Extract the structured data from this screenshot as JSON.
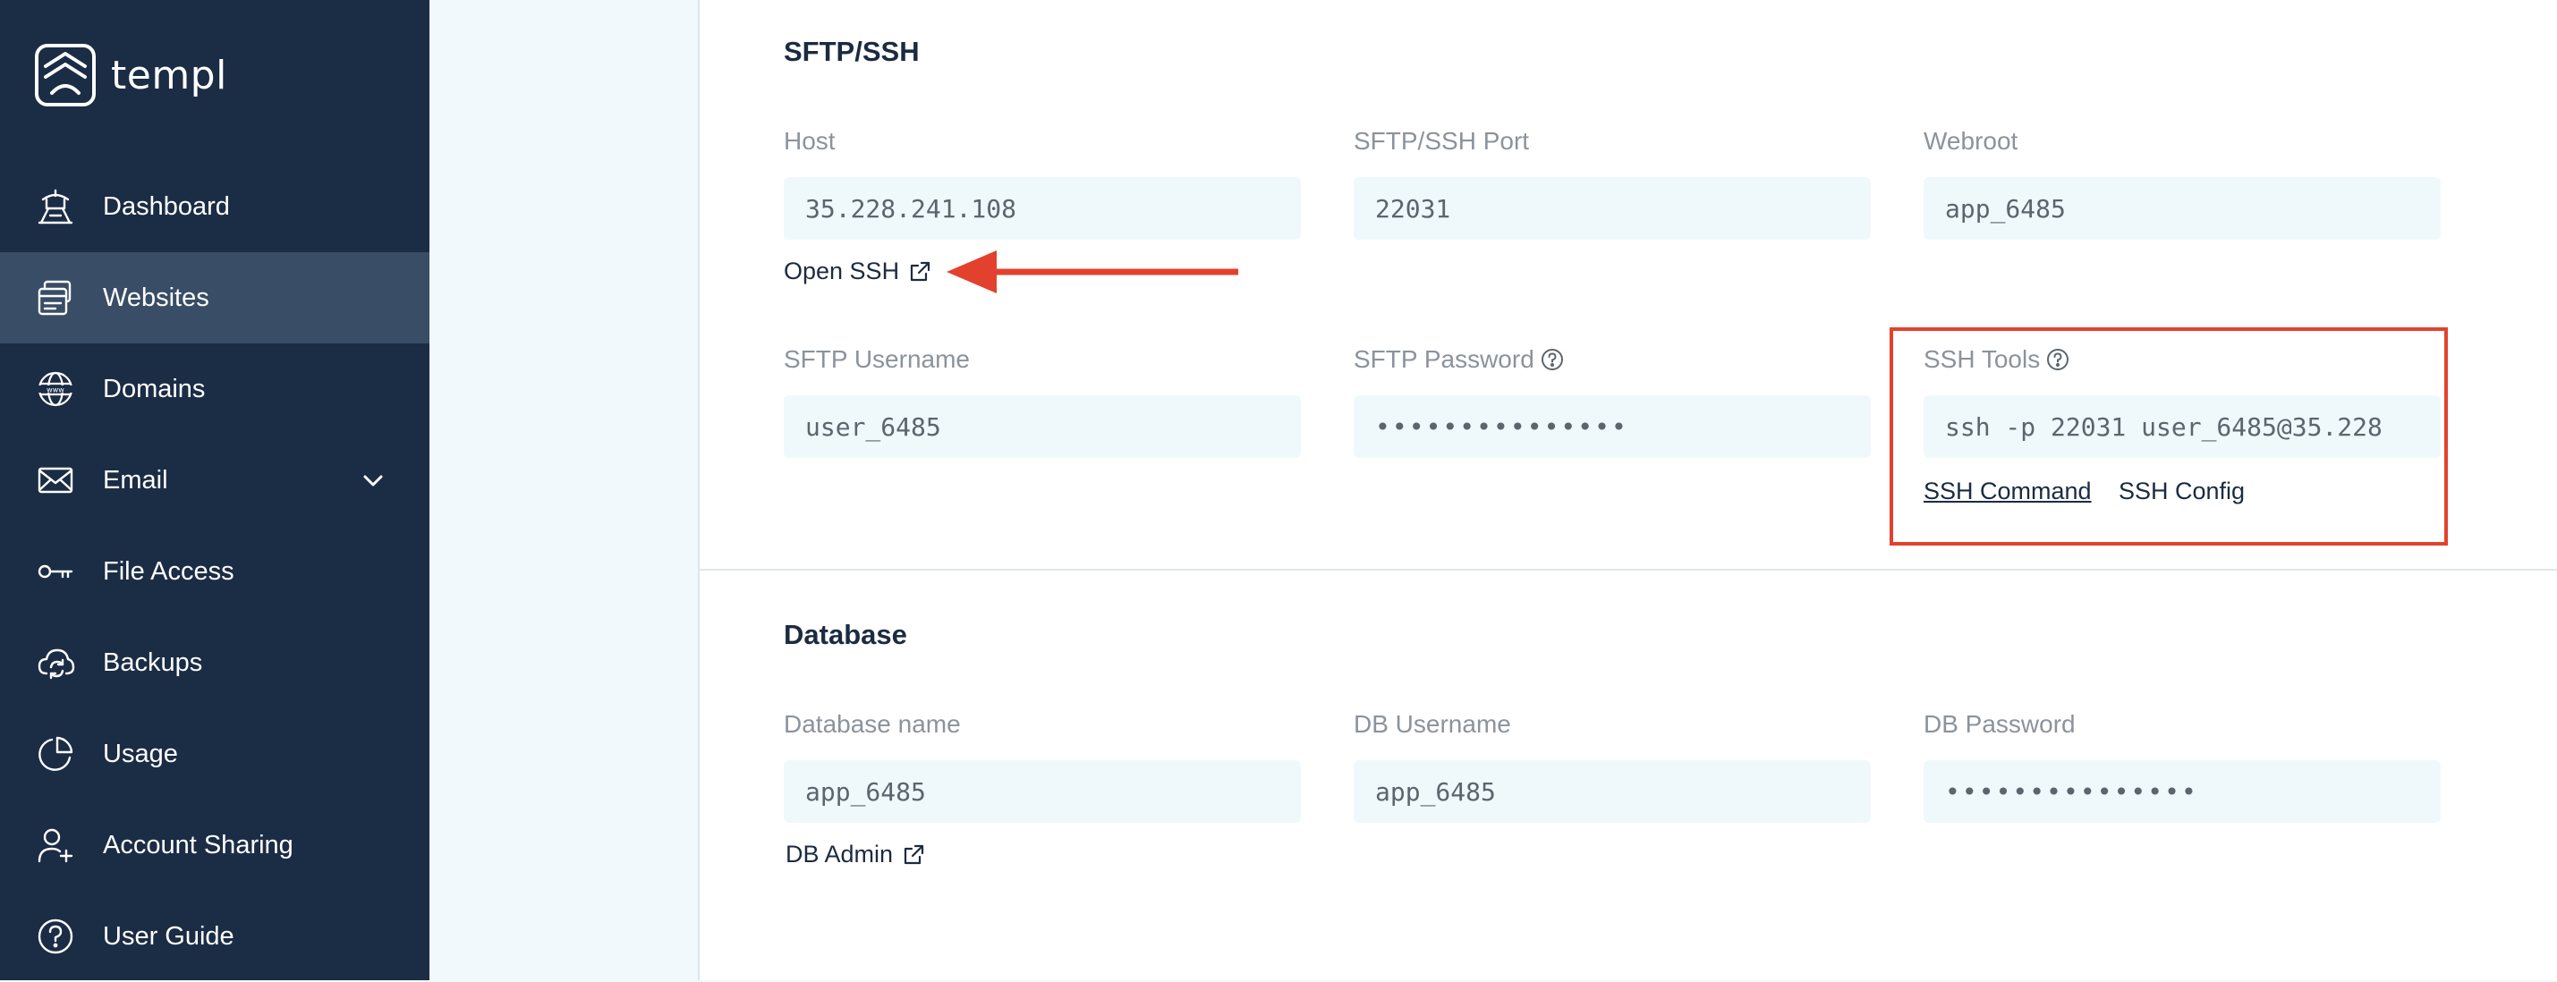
{
  "app": {
    "name": "templ"
  },
  "sidebar": {
    "items": [
      {
        "label": "Dashboard",
        "icon": "dashboard-icon",
        "active": false
      },
      {
        "label": "Websites",
        "icon": "websites-icon",
        "active": true
      },
      {
        "label": "Domains",
        "icon": "globe-www-icon",
        "active": false
      },
      {
        "label": "Email",
        "icon": "envelope-icon",
        "active": false,
        "has_submenu": true
      },
      {
        "label": "File Access",
        "icon": "key-icon",
        "active": false
      },
      {
        "label": "Backups",
        "icon": "cloud-sync-icon",
        "active": false
      },
      {
        "label": "Usage",
        "icon": "pie-chart-icon",
        "active": false
      },
      {
        "label": "Account Sharing",
        "icon": "user-add-icon",
        "active": false
      },
      {
        "label": "User Guide",
        "icon": "question-circle-icon",
        "active": false
      }
    ]
  },
  "sftp": {
    "title": "SFTP/SSH",
    "host": {
      "label": "Host",
      "value": "35.228.241.108"
    },
    "port": {
      "label": "SFTP/SSH Port",
      "value": "22031"
    },
    "webroot": {
      "label": "Webroot",
      "value": "app_6485"
    },
    "open_ssh": "Open SSH",
    "username": {
      "label": "SFTP Username",
      "value": "user_6485"
    },
    "password": {
      "label": "SFTP Password",
      "value": "•••••••••••••••"
    },
    "ssh_tools": {
      "label": "SSH Tools",
      "value": "ssh -p 22031 user_6485@35.228",
      "command_link": "SSH Command",
      "config_link": "SSH Config"
    }
  },
  "database": {
    "title": "Database",
    "name": {
      "label": "Database name",
      "value": "app_6485"
    },
    "username": {
      "label": "DB Username",
      "value": "app_6485"
    },
    "password": {
      "label": "DB Password",
      "value": "•••••••••••••••"
    },
    "admin_link": "DB Admin"
  },
  "colors": {
    "sidebar_bg": "#1b2c45",
    "sidebar_active": "#3a4d66",
    "field_bg": "#eff9fb",
    "annotation_red": "#e2422d"
  }
}
